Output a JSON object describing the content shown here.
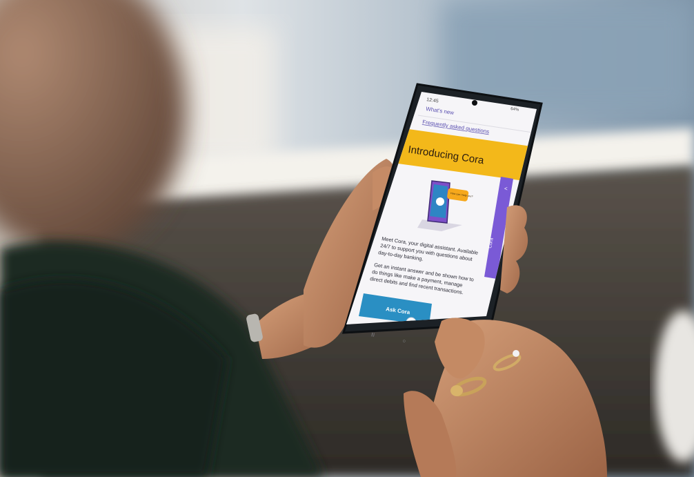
{
  "photo": {
    "description_hidden": "",
    "colors": {
      "window_light": "#d8dde2",
      "window_blue": "#8ea6bb",
      "sill_white": "#f2f0ea",
      "sofa_dark": "#3b3732",
      "sweater_dark": "#1e2a22",
      "skin": "#b87a58",
      "skin_light": "#d9a17c",
      "phone_body": "#1c2126",
      "screen_bg": "#f6f5f8",
      "banner_yellow": "#f3b81a",
      "tab_purple": "#7a5ad6",
      "button_blue": "#2a8fc3",
      "ring_gold": "#c9a25a"
    }
  },
  "phone": {
    "status_time": "12:45",
    "status_right": "64%",
    "nav_link_whats_new": "What's new",
    "nav_link_faq": "Frequently asked questions",
    "banner_title": "Introducing Cora",
    "speech_bubble": "How can I help you?",
    "side_tab_label": "Cora",
    "side_tab_chevron": "<",
    "body_para_1_line_1": "Meet Cora, your digital assistant. Available",
    "body_para_1_line_2": "24/7 to support you with questions about",
    "body_para_1_line_3": "day-to-day banking.",
    "body_para_2_line_1": "Get an instant answer and be shown how to",
    "body_para_2_line_2": "do things like make a payment, manage",
    "body_para_2_line_3": "direct debits and find recent transactions.",
    "ask_button": "Ask Cora",
    "nav_recents": "|||",
    "nav_home": "○"
  }
}
